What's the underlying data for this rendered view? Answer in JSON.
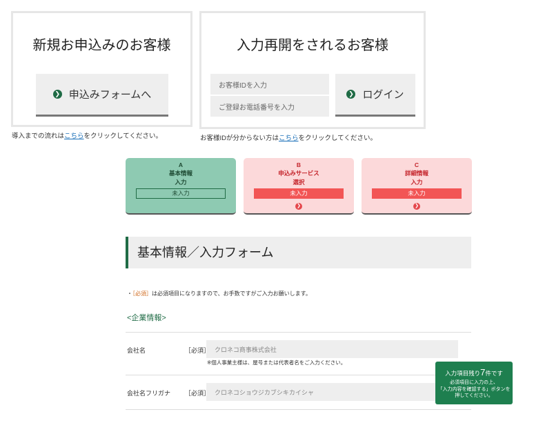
{
  "new_customer": {
    "title": "新規お申込みのお客様",
    "button_label": "申込みフォームへ",
    "note_prefix": "導入までの流れは",
    "note_link": "こちら",
    "note_suffix": "をクリックしてください。"
  },
  "returning_customer": {
    "title": "入力再開をされるお客様",
    "customer_id_placeholder": "お客様IDを入力",
    "phone_placeholder": "ご登録お電話番号を入力",
    "login_label": "ログイン",
    "note_prefix": "お客様IDが分からない方は",
    "note_link": "こちら",
    "note_suffix": "をクリックしてください。"
  },
  "steps": [
    {
      "letter": "A",
      "name": "基本情報",
      "action": "入力",
      "status": "未入力"
    },
    {
      "letter": "B",
      "name": "申込みサービス",
      "action": "選択",
      "status": "未入力"
    },
    {
      "letter": "C",
      "name": "詳細情報",
      "action": "入力",
      "status": "未入力"
    }
  ],
  "form": {
    "section_title": "基本情報／入力フォーム",
    "notice_bullet": "・",
    "notice_required": "［必須］",
    "notice_text": "は必須項目になりますので、お手数ですがご入力お願いします。",
    "group_label": "<企業情報>",
    "fields": [
      {
        "label": "会社名",
        "required": "［必須］",
        "placeholder": "クロネコ商事株式会社",
        "hint": "※個人事業主様は、屋号または代表者名をご入力ください。"
      },
      {
        "label": "会社名フリガナ",
        "required": "［必須］",
        "placeholder": "クロネコショウジカブシキカイシャ"
      }
    ]
  },
  "remaining_badge": {
    "prefix": "入力項目残り",
    "count": "7",
    "suffix": "件です",
    "line1": "必須項目に入力の上、",
    "line2": "「入力内容を確認する」ボタンを",
    "line3": "押してください。"
  },
  "colors": {
    "accent_green": "#1f6b45",
    "step_green_bg": "#8ecab2",
    "step_pink_bg": "#fcd9da",
    "status_red": "#f25555",
    "required_orange": "#d06a1e",
    "link_blue": "#1a6fb8"
  },
  "icons": {
    "button_arrow": "chevron-right-circle-icon"
  }
}
